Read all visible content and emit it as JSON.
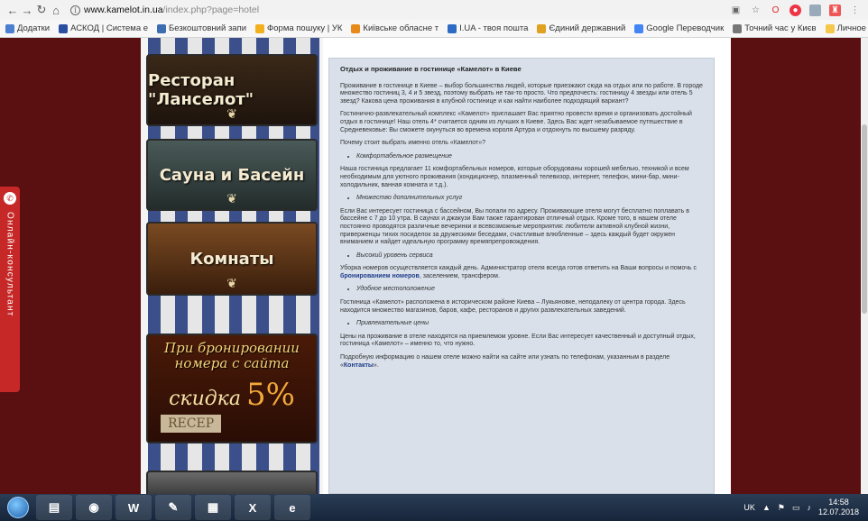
{
  "browser": {
    "url_host": "www.kamelot.in.ua",
    "url_path": "/index.php?page=hotel",
    "bookmarks": [
      {
        "label": "Додатки",
        "icon": "apps-icon",
        "color": "#4a7fd1"
      },
      {
        "label": "АСКОД | Система е",
        "icon": "askod-icon",
        "color": "#2b4fa0"
      },
      {
        "label": "Безкоштовний запи",
        "icon": "page-icon",
        "color": "#3b6db0"
      },
      {
        "label": "Форма пошуку | УК",
        "icon": "bulb-icon",
        "color": "#f2b01e"
      },
      {
        "label": "Київське обласне т",
        "icon": "flower-icon",
        "color": "#e88a1a"
      },
      {
        "label": "I.UA - твоя пошта",
        "icon": "mail-icon",
        "color": "#2d6bc4"
      },
      {
        "label": "Єдиний державний",
        "icon": "person-icon",
        "color": "#e0a020"
      },
      {
        "label": "Google Переводчик",
        "icon": "translate-icon",
        "color": "#4285f4"
      },
      {
        "label": "Точний час у Києв",
        "icon": "clock-icon",
        "color": "#777777"
      },
      {
        "label": "Личное",
        "icon": "folder-icon",
        "color": "#f5c84a"
      }
    ]
  },
  "sidebar": {
    "consult_label": "Онлайн-консультант",
    "banners": {
      "restaurant": "Ресторан \"Ланселот\"",
      "sauna": "Сауна и Басейн",
      "rooms": "Комнаты",
      "promo_line1": "При бронировании",
      "promo_line2": "номера с сайта",
      "promo_discount": "скидка",
      "promo_percent": "5%",
      "promo_recep": "RECEP"
    }
  },
  "article": {
    "title": "Отдых и проживание в гостинице «Камелот» в Киеве",
    "p1": "Проживание в гостинице в Киеве – выбор большинства людей, которые приезжают сюда на отдых или по работе. В городе множество гостиниц 3, 4 и 5 звезд, поэтому выбрать не так-то просто. Что предпочесть: гостиницу 4 звезды или отель 5 звезд? Какова цена проживания в клубной гостинице и как найти наиболее подходящий вариант?",
    "p2": "Гостинично-развлекательный комплекс «Камелот» приглашает Вас приятно провести время и организовать достойный отдых в гостинице! Наш отель 4* считается одним из лучших в Киеве. Здесь Вас ждет незабываемое путешествие в Средневековье: Вы сможете окунуться во времена короля Артура и отдохнуть по высшему разряду.",
    "p3": "Почему стоит выбрать именно отель «Камелот»?",
    "b1": "Комфортабельное размещение",
    "p4": "Наша гостиница предлагает 11 комфортабельных номеров, которые оборудованы хорошей мебелью, техникой и всем необходимым для уютного проживания (кондиционер, плазменный телевизор, интернет, телефон, мини-бар, мини-холодильник, ванная комната и т.д.).",
    "b2": "Множество дополнительных услуг",
    "p5": "Если Вас интересует гостиница с бассейном, Вы попали по адресу. Проживающие отеля могут бесплатно поплавать в бассейне с 7 до 10 утра. В саунах и джакузи Вам также гарантирован отличный отдых. Кроме того, в нашем отеле постоянно проводятся различные вечеринки и всевозможные мероприятия: любители активной клубной жизни, приверженцы тихих посиделок за дружескими беседами, счастливые влюбленные – здесь каждый будет окружен вниманием и найдет идеальную программу времяпрепровождения.",
    "b3": "Высокий уровень сервиса",
    "p6_before": "Уборка номеров осуществляется каждый день. Администратор отеля всегда готов ответить на Ваши вопросы и помочь с ",
    "p6_link": "бронированием номеров",
    "p6_after": ", заселением, трансфером.",
    "b4": "Удобное местоположение",
    "p7": "Гостиница «Камелот» расположена в историческом районе Киева – Лукьяновке, неподалеку от центра города. Здесь находится множество магазинов, баров, кафе, ресторанов и других развлекательных заведений.",
    "b5": "Привлекательные цены",
    "p8": "Цены на проживание в отеле находятся на приемлемом уровне. Если Вас интересует качественный и доступный отдых, гостиница «Камелот» – именно то, что нужно.",
    "p9_before": "Подробную информацию о нашем отеле можно найти на сайте или узнать по телефонам, указанным в разделе «",
    "p9_link": "Контакты",
    "p9_after": "»."
  },
  "taskbar": {
    "apps": [
      {
        "icon": "folder-icon",
        "glyph": "▤"
      },
      {
        "icon": "chrome-icon",
        "glyph": "◉"
      },
      {
        "icon": "word-icon",
        "glyph": "W"
      },
      {
        "icon": "paint-icon",
        "glyph": "✎"
      },
      {
        "icon": "notepad-icon",
        "glyph": "▦"
      },
      {
        "icon": "excel-icon",
        "glyph": "X"
      },
      {
        "icon": "ie-icon",
        "glyph": "e"
      }
    ],
    "lang": "UK",
    "time": "14:58",
    "date": "12.07.2018"
  }
}
